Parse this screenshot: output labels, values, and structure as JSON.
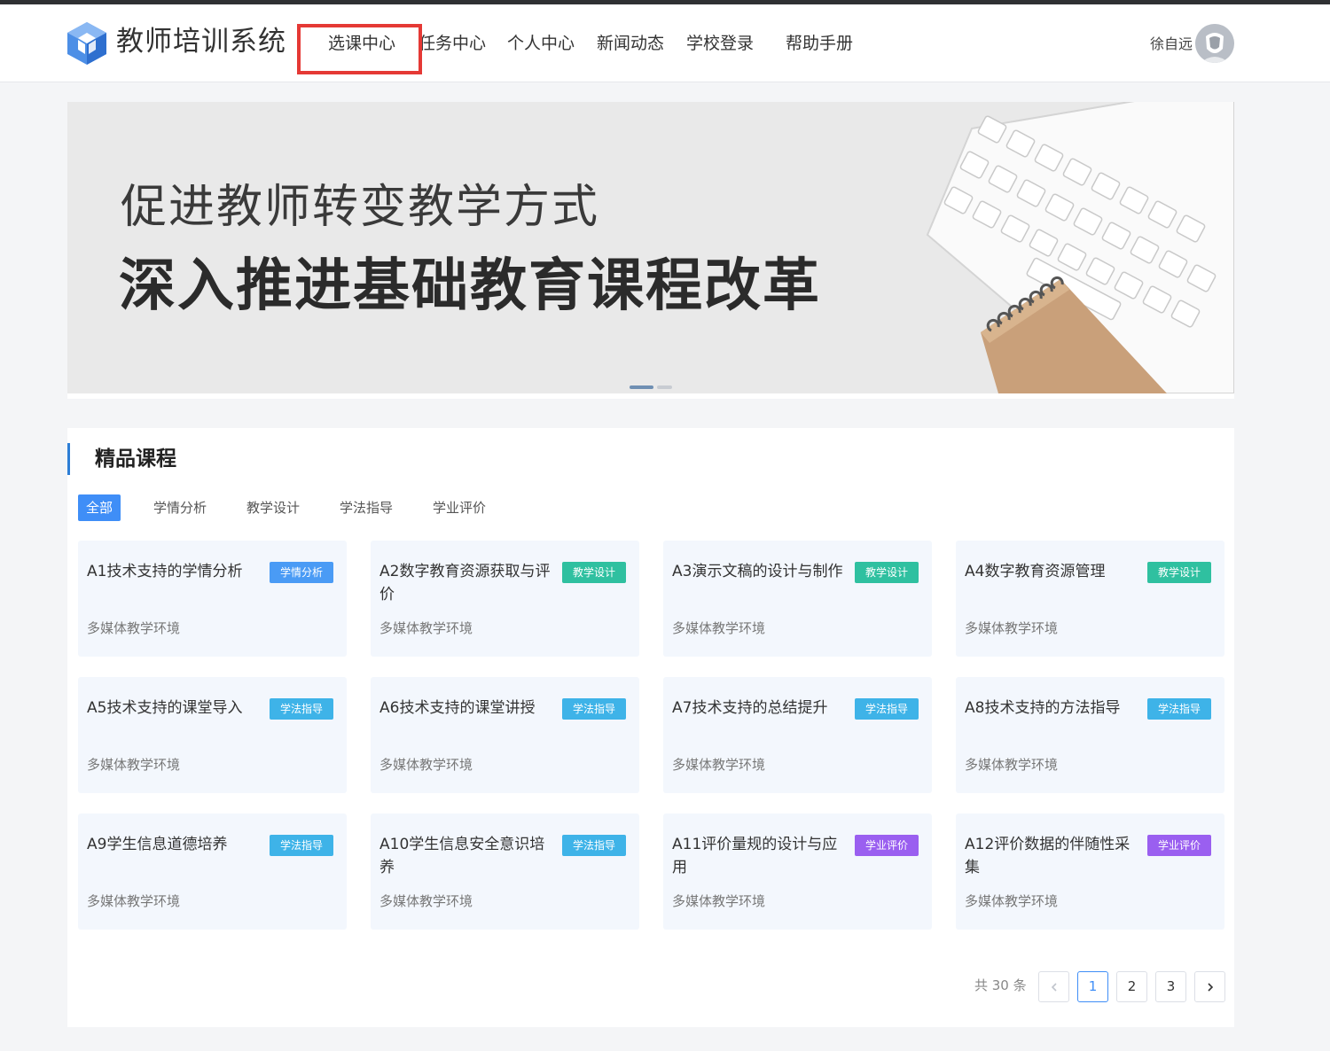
{
  "header": {
    "site_title": "教师培训系统",
    "nav": [
      "选课中心",
      "任务中心",
      "个人中心",
      "新闻动态",
      "学校登录",
      "帮助手册"
    ],
    "username": "徐自远"
  },
  "banner": {
    "line1": "促进教师转变教学方式",
    "line2": "深入推进基础教育课程改革"
  },
  "section": {
    "title": "精品课程",
    "filters": [
      "全部",
      "学情分析",
      "教学设计",
      "学法指导",
      "学业评价"
    ],
    "active_filter": "全部"
  },
  "courses": [
    {
      "title": "A1技术支持的学情分析",
      "tag": "学情分析",
      "sub": "多媒体教学环境"
    },
    {
      "title": "A2数字教育资源获取与评价",
      "tag": "教学设计",
      "sub": "多媒体教学环境"
    },
    {
      "title": "A3演示文稿的设计与制作",
      "tag": "教学设计",
      "sub": "多媒体教学环境"
    },
    {
      "title": "A4数字教育资源管理",
      "tag": "教学设计",
      "sub": "多媒体教学环境"
    },
    {
      "title": "A5技术支持的课堂导入",
      "tag": "学法指导",
      "sub": "多媒体教学环境"
    },
    {
      "title": "A6技术支持的课堂讲授",
      "tag": "学法指导",
      "sub": "多媒体教学环境"
    },
    {
      "title": "A7技术支持的总结提升",
      "tag": "学法指导",
      "sub": "多媒体教学环境"
    },
    {
      "title": "A8技术支持的方法指导",
      "tag": "学法指导",
      "sub": "多媒体教学环境"
    },
    {
      "title": "A9学生信息道德培养",
      "tag": "学法指导",
      "sub": "多媒体教学环境"
    },
    {
      "title": "A10学生信息安全意识培养",
      "tag": "学法指导",
      "sub": "多媒体教学环境"
    },
    {
      "title": "A11评价量规的设计与应用",
      "tag": "学业评价",
      "sub": "多媒体教学环境"
    },
    {
      "title": "A12评价数据的伴随性采集",
      "tag": "学业评价",
      "sub": "多媒体教学环境"
    }
  ],
  "tag_colors": {
    "学情分析": "#4a9bf5",
    "教学设计": "#2fc0a0",
    "学法指导": "#3eb3e8",
    "学业评价": "#9a5ff0"
  },
  "pagination": {
    "total_label": "共 30 条",
    "pages": [
      "1",
      "2",
      "3"
    ],
    "current": "1",
    "prev_icon": "chevron-left-icon",
    "next_icon": "chevron-right-icon"
  }
}
